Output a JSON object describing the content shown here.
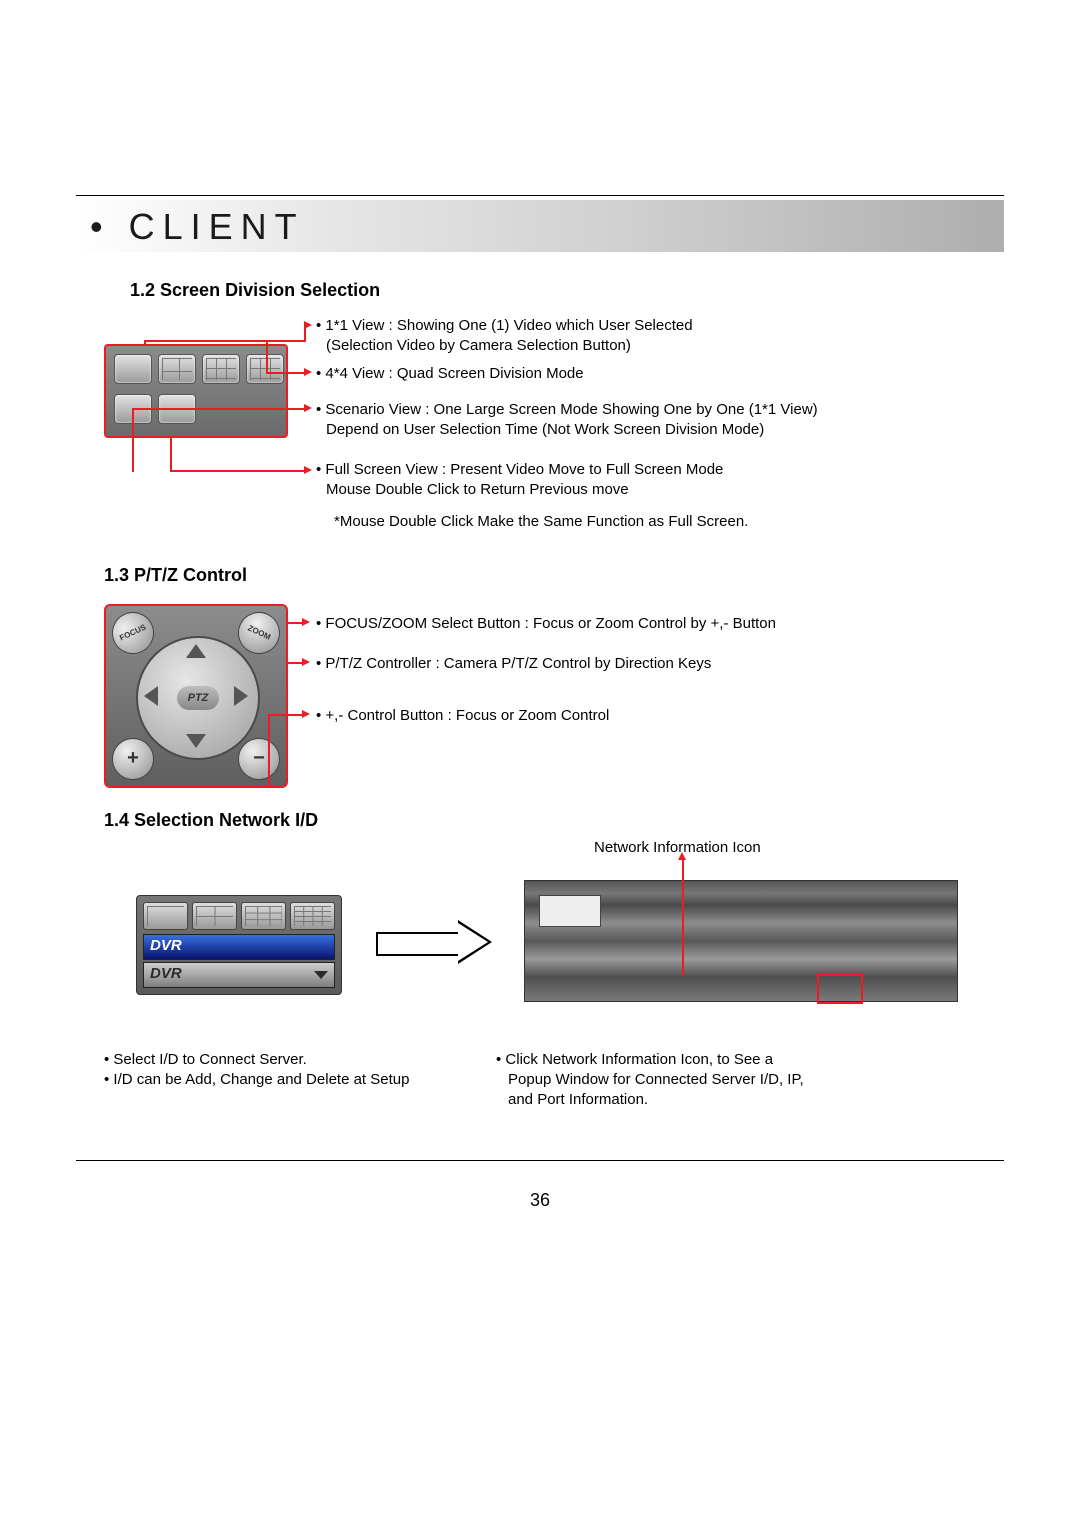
{
  "header": {
    "title": "CLIENT",
    "bullet": "•"
  },
  "page_number": "36",
  "s12": {
    "heading": "1.2 Screen Division Selection",
    "view11_a": "• 1*1 View : Showing One (1) Video which User Selected",
    "view11_b": "(Selection Video by Camera Selection Button)",
    "view44": "• 4*4 View : Quad Screen Division Mode",
    "scenario_a": "• Scenario View : One Large Screen Mode Showing One by One (1*1 View)",
    "scenario_b": "Depend on User Selection Time (Not Work Screen Division Mode)",
    "full_a": "• Full Screen View : Present Video Move to Full Screen Mode",
    "full_b": "Mouse Double Click to Return Previous move",
    "note": "*Mouse Double Click Make the Same Function as Full Screen."
  },
  "s13": {
    "heading": "1.3 P/T/Z Control",
    "focus_zoom": "• FOCUS/ZOOM Select Button : Focus or Zoom Control by +,- Button",
    "ptz_ctrl": "• P/T/Z Controller : Camera P/T/Z Control by Direction Keys",
    "plus_minus": "• +,- Control Button : Focus or Zoom Control",
    "ptz_label": "PTZ",
    "focus_label": "FOCUS",
    "zoom_label": "ZOOM",
    "plus": "+",
    "minus": "−"
  },
  "s14": {
    "heading": "1.4 Selection Network I/D",
    "net_icon_label": "Network Information Icon",
    "dvr1": "DVR",
    "dvr2": "DVR",
    "left1": "• Select I/D to Connect Server.",
    "left2": "• I/D can be Add, Change and Delete at Setup",
    "right1": "• Click Network Information Icon, to See a",
    "right2": "Popup Window for Connected Server I/D, IP,",
    "right3": "and Port Information."
  }
}
